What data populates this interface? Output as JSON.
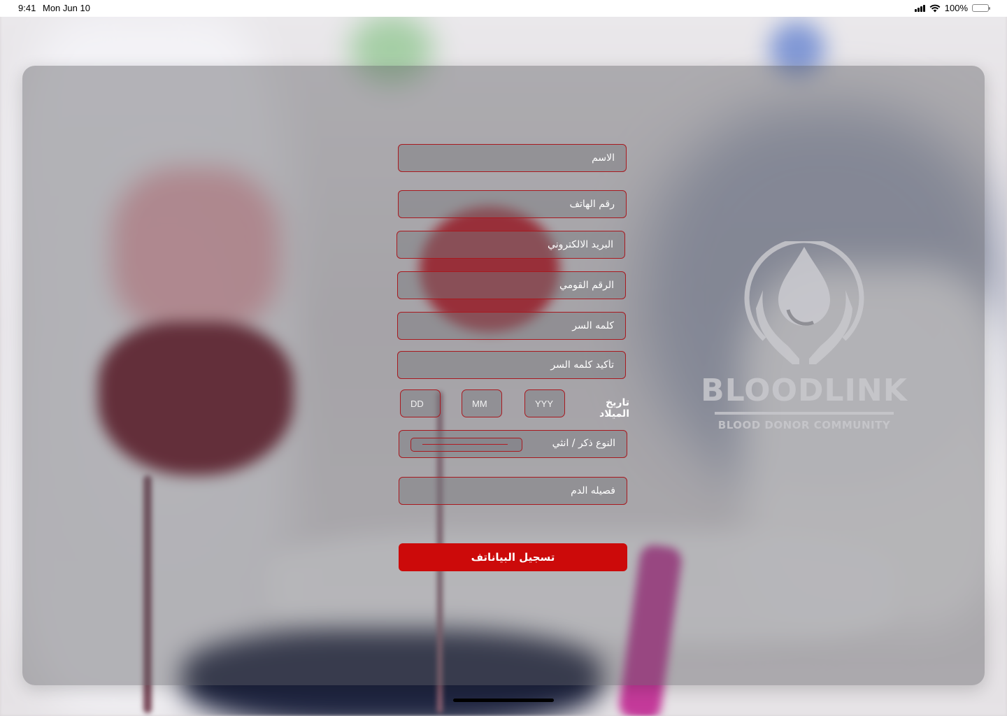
{
  "status_bar": {
    "time": "9:41",
    "date": "Mon Jun 10",
    "battery": "100%"
  },
  "form": {
    "name_placeholder": "الاسم",
    "phone_placeholder": "رقم الهاتف",
    "email_placeholder": "البريد الالكتروني",
    "national_id_placeholder": "الرقم القومي",
    "password_placeholder": "كلمه السر",
    "confirm_password_placeholder": "تأكيد كلمه السر",
    "dob_label": "تاريخ الميلاد",
    "dob_day_placeholder": "DD",
    "dob_month_placeholder": "MM",
    "dob_year_placeholder": "YYY",
    "gender_label": "النوع ذكر / انثي",
    "blood_type_placeholder": "فصيله الدم",
    "submit_label": "تسجيل البياناتف"
  },
  "logo": {
    "name": "BLOODLINK",
    "tagline": "BLOOD DONOR COMMUNITY"
  },
  "colors": {
    "accent": "#cc0a0a",
    "field_border": "#a8191f"
  }
}
